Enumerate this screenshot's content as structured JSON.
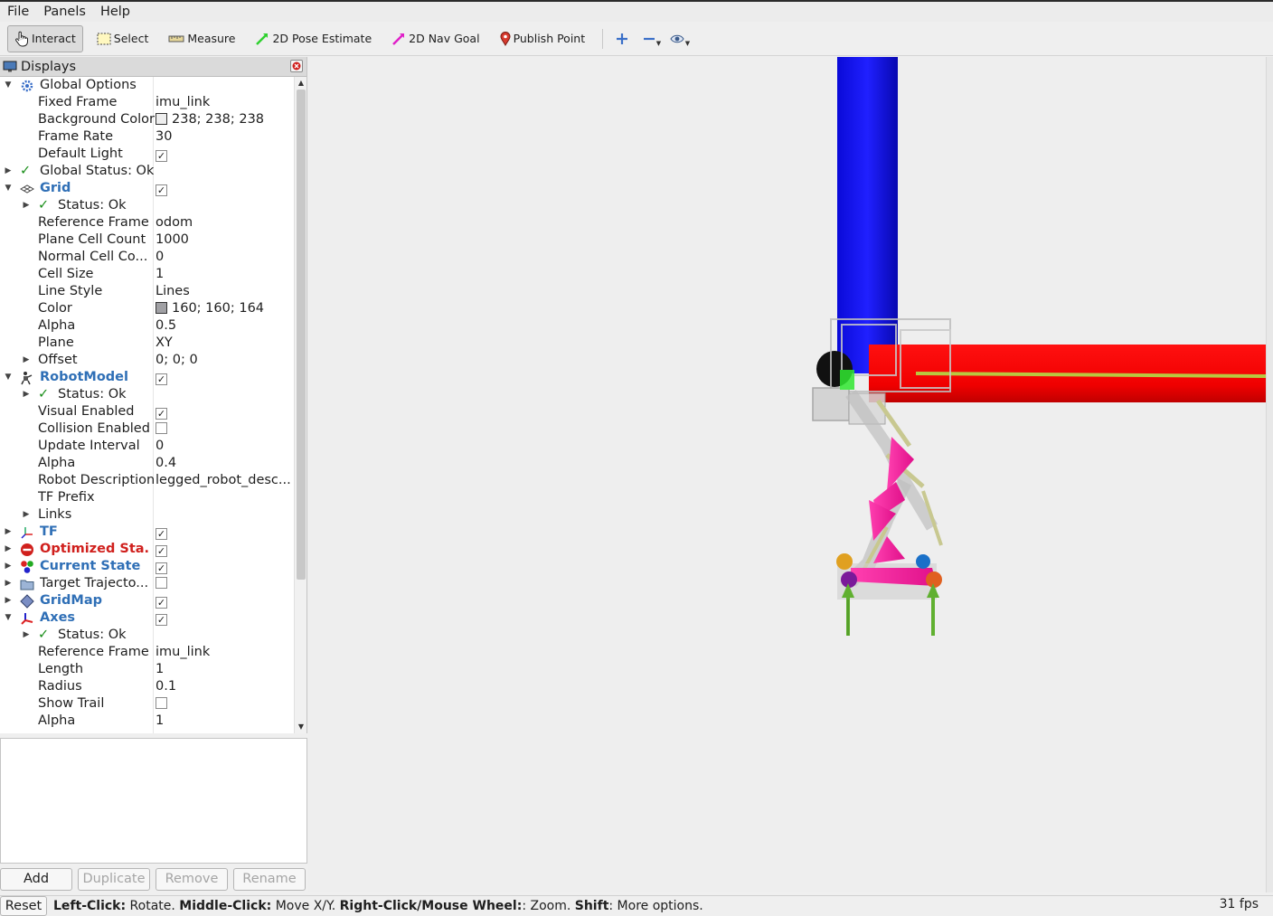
{
  "menu": {
    "file": "File",
    "panels": "Panels",
    "help": "Help"
  },
  "toolbar": {
    "interact": "Interact",
    "select": "Select",
    "measure": "Measure",
    "pose_estimate": "2D Pose Estimate",
    "nav_goal": "2D Nav Goal",
    "publish_point": "Publish Point"
  },
  "displays": {
    "title": "Displays",
    "rows": [
      {
        "label": "Global Options"
      },
      {
        "label": "Fixed Frame",
        "value": "imu_link"
      },
      {
        "label": "Background Color",
        "value": "238; 238; 238"
      },
      {
        "label": "Frame Rate",
        "value": "30"
      },
      {
        "label": "Default Light"
      },
      {
        "label": "Global Status: Ok"
      },
      {
        "label": "Grid"
      },
      {
        "label": "Status: Ok"
      },
      {
        "label": "Reference Frame",
        "value": "odom"
      },
      {
        "label": "Plane Cell Count",
        "value": "1000"
      },
      {
        "label": "Normal Cell Co...",
        "value": "0"
      },
      {
        "label": "Cell Size",
        "value": "1"
      },
      {
        "label": "Line Style",
        "value": "Lines"
      },
      {
        "label": "Color",
        "value": "160; 160; 164"
      },
      {
        "label": "Alpha",
        "value": "0.5"
      },
      {
        "label": "Plane",
        "value": "XY"
      },
      {
        "label": "Offset",
        "value": "0; 0; 0"
      },
      {
        "label": "RobotModel"
      },
      {
        "label": "Status: Ok"
      },
      {
        "label": "Visual Enabled"
      },
      {
        "label": "Collision Enabled"
      },
      {
        "label": "Update Interval",
        "value": "0"
      },
      {
        "label": "Alpha",
        "value": "0.4"
      },
      {
        "label": "Robot Description",
        "value": "legged_robot_desc..."
      },
      {
        "label": "TF Prefix"
      },
      {
        "label": "Links"
      },
      {
        "label": "TF"
      },
      {
        "label": "Optimized Sta..."
      },
      {
        "label": "Current State"
      },
      {
        "label": "Target Trajecto..."
      },
      {
        "label": "GridMap"
      },
      {
        "label": "Axes"
      },
      {
        "label": "Status: Ok"
      },
      {
        "label": "Reference Frame",
        "value": "imu_link"
      },
      {
        "label": "Length",
        "value": "1"
      },
      {
        "label": "Radius",
        "value": "0.1"
      },
      {
        "label": "Show Trail"
      },
      {
        "label": "Alpha",
        "value": "1"
      }
    ]
  },
  "colors": {
    "background": "#eeeeee",
    "grid_swatch": "#a0a0a4",
    "accent_blue": "#2f6fb6",
    "error_red": "#d0201d"
  },
  "buttons": {
    "add": "Add",
    "duplicate": "Duplicate",
    "remove": "Remove",
    "rename": "Rename"
  },
  "status": {
    "reset": "Reset",
    "left_click_key": "Left-Click:",
    "left_click_desc": " Rotate. ",
    "middle_click_key": "Middle-Click:",
    "middle_click_desc": " Move X/Y. ",
    "right_click_key": "Right-Click/Mouse Wheel:",
    "right_click_desc": ": Zoom. ",
    "shift_key": "Shift",
    "shift_desc": ": More options.",
    "fps": "31 fps"
  }
}
